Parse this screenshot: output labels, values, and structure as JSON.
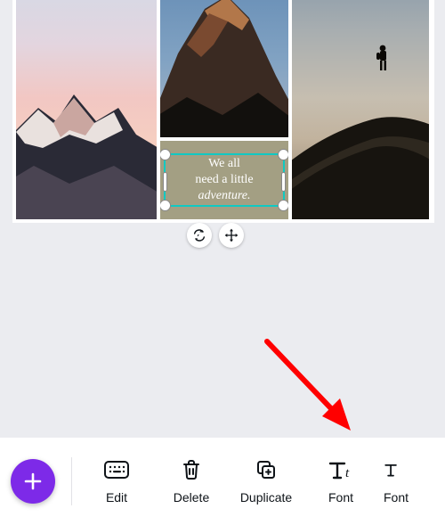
{
  "quote": {
    "line1": "We all",
    "line2": "need a little",
    "line3": "adventure."
  },
  "toolbar": {
    "edit": "Edit",
    "delete": "Delete",
    "duplicate": "Duplicate",
    "font": "Font",
    "fontsize": "Font"
  },
  "colors": {
    "accent": "#7d2ae8",
    "selection": "#10c9c3",
    "arrow": "#ff0000"
  }
}
